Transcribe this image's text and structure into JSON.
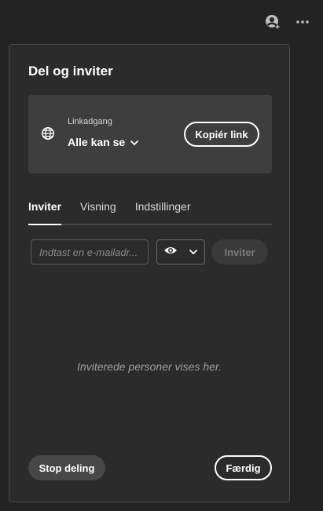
{
  "topbar": {
    "icons": [
      "add-person-icon",
      "more-icon"
    ]
  },
  "panel": {
    "title": "Del og inviter"
  },
  "link_card": {
    "label": "Linkadgang",
    "access": "Alle kan se",
    "copy_button": "Kopiér link",
    "icon": "globe-icon"
  },
  "tabs": [
    {
      "label": "Inviter",
      "active": true
    },
    {
      "label": "Visning",
      "active": false
    },
    {
      "label": "Indstillinger",
      "active": false
    }
  ],
  "invite": {
    "email_placeholder": "Indtast en e-mailadr...",
    "email_value": "",
    "permission_icon": "eye-icon",
    "invite_button": "Inviter"
  },
  "empty_state": "Inviterede personer vises her.",
  "footer": {
    "stop_button": "Stop deling",
    "done_button": "Færdig"
  }
}
